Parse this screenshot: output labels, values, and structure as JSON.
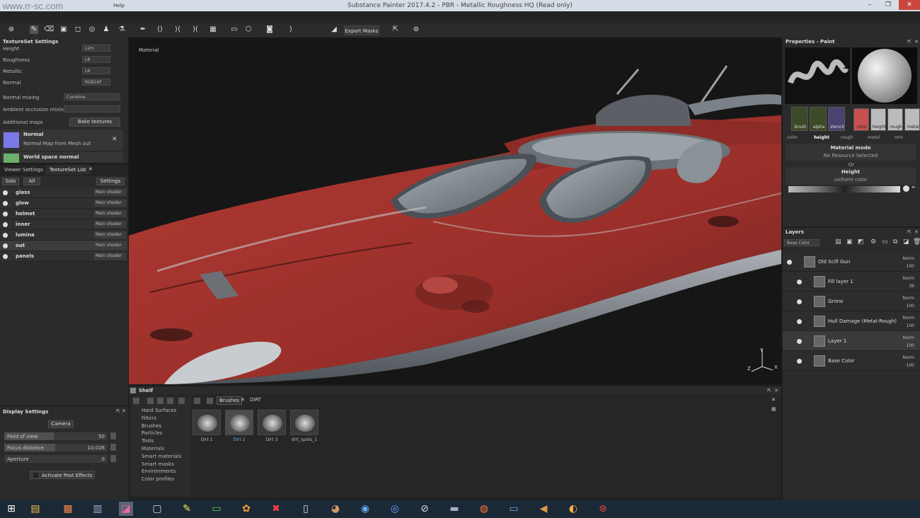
{
  "window": {
    "title": "Substance Painter 2017.4.2 - PBR - Metallic Roughness HQ (Read only)",
    "watermark": "www.rr-sc.com",
    "help": "Help",
    "minimize": "–",
    "maximize": "❐",
    "close": "✕"
  },
  "toolbar": {
    "export_masks": "Export Masks"
  },
  "textureset_settings": {
    "title": "TextureSet Settings",
    "height_label": "Height",
    "height_value": "L2m",
    "roughness_label": "Roughness",
    "roughness_value": "L8",
    "metallic_label": "Metallic",
    "metallic_value": "L8",
    "normal_label": "Normal",
    "normal_value": "RGB16F",
    "normal_mixing_label": "Normal mixing",
    "normal_mixing_value": "Combine",
    "ao_mixing_label": "Ambient occlusion mixing",
    "additional_maps_label": "Additional maps",
    "bake_textures": "Bake textures",
    "map1_name": "Normal",
    "map1_desc": "Normal Map from Mesh out",
    "map2_name": "World space normal"
  },
  "tabs": {
    "viewer_settings": "Viewer Settings",
    "textureset_list": "TextureSet List"
  },
  "textureset_list": {
    "solo": "Solo",
    "all": "All",
    "settings": "Settings",
    "items": [
      {
        "name": "glass",
        "shader": "Main shader"
      },
      {
        "name": "glow",
        "shader": "Main shader"
      },
      {
        "name": "helmet",
        "shader": "Main shader"
      },
      {
        "name": "inner",
        "shader": "Main shader"
      },
      {
        "name": "lumina",
        "shader": "Main shader"
      },
      {
        "name": "out",
        "shader": "Main shader"
      },
      {
        "name": "panels",
        "shader": "Main shader"
      }
    ]
  },
  "display_settings": {
    "title": "Display Settings",
    "camera": "Camera",
    "fov_label": "Field of view",
    "fov_value": "50",
    "focus_label": "Focus distance",
    "focus_value": "10.026",
    "aperture_label": "Aperture",
    "aperture_value": "0",
    "post_effects": "Activate Post Effects"
  },
  "viewport": {
    "label": "Material"
  },
  "properties": {
    "title": "Properties - Paint",
    "slots": [
      "brush",
      "alpha",
      "stencil"
    ],
    "channels": [
      "color",
      "height",
      "rough",
      "metal"
    ],
    "channel_tabs": [
      "color",
      "height",
      "rough",
      "metal",
      "nrm"
    ],
    "material_mode": "Material mode",
    "no_resource": "No Resource Selected",
    "or": "Or",
    "height_label": "Height",
    "uniform_color": "uniform color"
  },
  "layers": {
    "title": "Layers",
    "channel_select": "Base Color",
    "items": [
      {
        "name": "Old Scifi Gun",
        "blend": "Norm",
        "opacity": "100"
      },
      {
        "name": "Fill layer 1",
        "blend": "Norm",
        "opacity": "39"
      },
      {
        "name": "Grime",
        "blend": "Norm",
        "opacity": "100"
      },
      {
        "name": "Hull Damage (Metal-Rough)",
        "blend": "Norm",
        "opacity": "100"
      },
      {
        "name": "Layer 1",
        "blend": "Norm",
        "opacity": "100"
      },
      {
        "name": "Base Color",
        "blend": "Norm",
        "opacity": "100"
      }
    ]
  },
  "shelf": {
    "title": "Shelf",
    "tabs": [
      "Brushes",
      "DIRT"
    ],
    "categories": [
      "Hard Surfaces",
      "Filters",
      "Brushes",
      "Particles",
      "Tools",
      "Materials",
      "Smart materials",
      "Smart masks",
      "Environments",
      "Color profiles"
    ],
    "items": [
      "Dirt 1",
      "Dirt 2",
      "Dirt 3",
      "dirt_spots_1"
    ]
  },
  "colors": {
    "accent": "#4a8fd6",
    "hull_red": "#a8322c",
    "panel_bg": "#2b2b2b"
  }
}
